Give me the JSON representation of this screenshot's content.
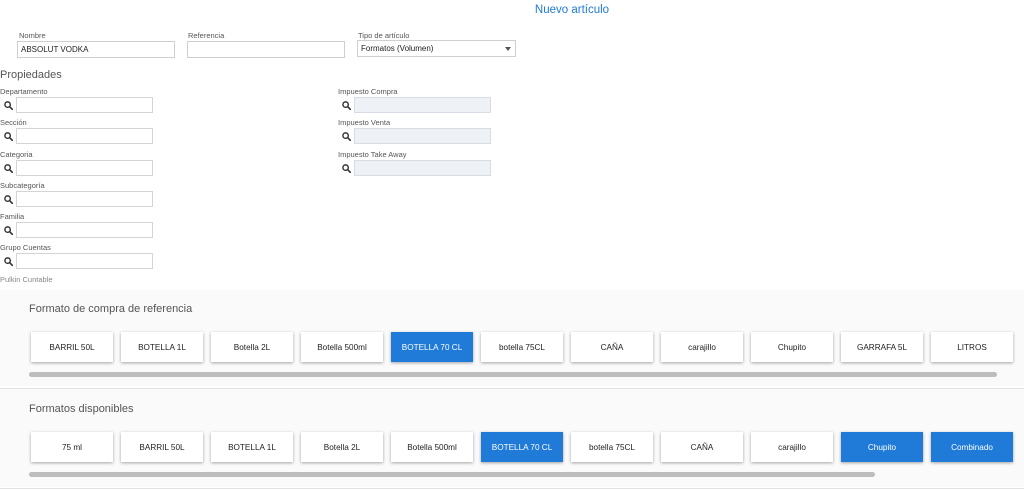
{
  "header": {
    "title": "Nuevo artículo"
  },
  "form": {
    "nombre": {
      "label": "Nombre",
      "value": "ABSOLUT VODKA"
    },
    "referencia": {
      "label": "Referencia",
      "value": ""
    },
    "tipo": {
      "label": "Tipo de artículo",
      "value": "Formatos (Volumen)"
    }
  },
  "propiedades": {
    "title": "Propiedades",
    "left": [
      {
        "label": "Departamento"
      },
      {
        "label": "Sección"
      },
      {
        "label": "Categoria"
      },
      {
        "label": "Subcategoría"
      },
      {
        "label": "Familia"
      },
      {
        "label": "Grupo Cuentas"
      }
    ],
    "right": [
      {
        "label": "Impuesto Compra"
      },
      {
        "label": "Impuesto Venta"
      },
      {
        "label": "Impuesto Take Away"
      }
    ]
  },
  "compra": {
    "title": "Formato de compra de referencia",
    "selected_index": 4,
    "items": [
      "BARRIL 50L",
      "BOTELLA 1L",
      "Botella 2L",
      "Botella 500ml",
      "BOTELLA 70 CL",
      "botella 75CL",
      "CAÑA",
      "carajillo",
      "Chupito",
      "GARRAFA 5L",
      "LITROS"
    ]
  },
  "disponibles": {
    "title": "Formatos disponibles",
    "selected_indices": [
      5,
      9,
      10
    ],
    "items": [
      "75 ml",
      "BARRIL 50L",
      "BOTELLA 1L",
      "Botella 2L",
      "Botella 500ml",
      "BOTELLA 70 CL",
      "botella 75CL",
      "CAÑA",
      "carajillo",
      "Chupito",
      "Combinado"
    ]
  },
  "colors": {
    "accent": "#1f7ad8",
    "disabled_field": "#eef2f6"
  },
  "icons": {
    "search": "search-icon",
    "dropdown": "chevron-down-icon"
  }
}
